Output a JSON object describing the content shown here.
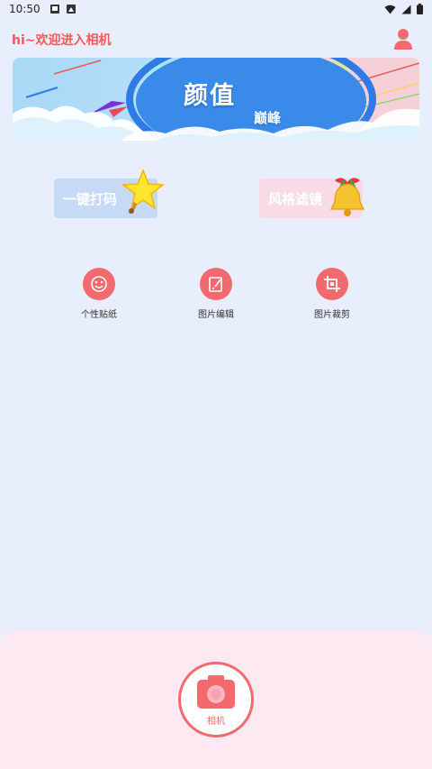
{
  "status_bar": {
    "time": "10:50",
    "icons": [
      "gallery-notification-icon",
      "photo-notification-icon",
      "wifi-icon",
      "signal-icon",
      "battery-icon"
    ]
  },
  "header": {
    "title": "hi~欢迎进入相机",
    "profile_icon": "user-icon"
  },
  "banner": {
    "title": "颜值",
    "subtitle": "巅峰"
  },
  "features": [
    {
      "label": "一键打码",
      "icon": "star-bell-icon"
    },
    {
      "label": "风格滤镜",
      "icon": "golden-bell-icon"
    }
  ],
  "tools": [
    {
      "label": "个性贴纸",
      "icon": "smiley-sticker-icon"
    },
    {
      "label": "图片编辑",
      "icon": "edit-document-icon"
    },
    {
      "label": "图片裁剪",
      "icon": "crop-icon"
    }
  ],
  "camera": {
    "label": "相机",
    "icon": "camera-icon"
  },
  "colors": {
    "accent": "#f26a6d",
    "title_red": "#f0585c",
    "background": "#e8eefb",
    "bottom_panel": "#fde9f1"
  }
}
